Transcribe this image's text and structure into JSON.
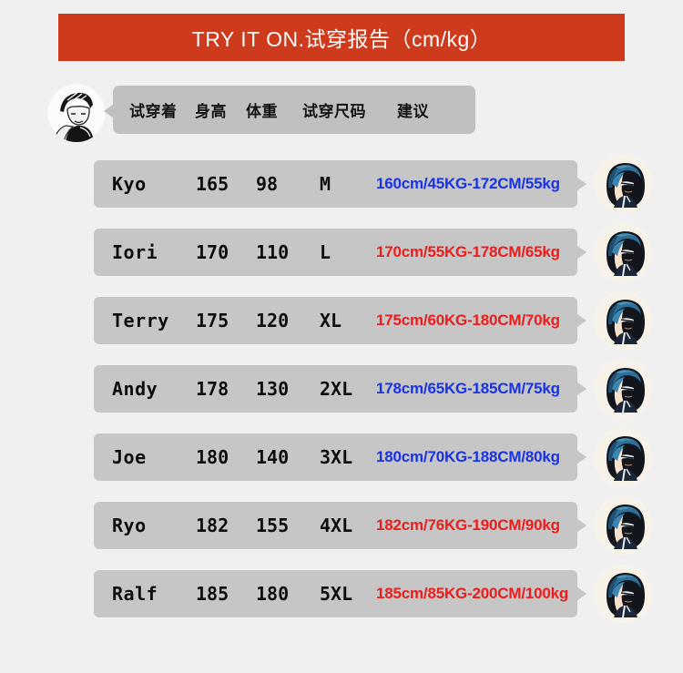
{
  "banner": {
    "title": "TRY IT ON.试穿报告（cm/kg）",
    "bg_color": "#ce3a1c",
    "text_color": "#fdfdfd"
  },
  "header": {
    "avatar_name": "sketch-avatar-icon",
    "columns": [
      "试穿着",
      "身高",
      "体重",
      "试穿尺码",
      "建议"
    ]
  },
  "colors": {
    "page_bg": "#f0f0f0",
    "row_bg": "#c6c6c6",
    "header_bubble_bg": "#c0c0c0",
    "blue": "#1832e6",
    "red": "#ec1c1c",
    "text": "#0d0d0d"
  },
  "rows": [
    {
      "name": "Kyo",
      "height": "165",
      "weight": "98",
      "size": "M",
      "recommendation": "160cm/45KG-172CM/55kg",
      "rec_color": "#1832e6",
      "avatar_name": "anime-boy-avatar-icon"
    },
    {
      "name": "Iori",
      "height": "170",
      "weight": "110",
      "size": "L",
      "recommendation": "170cm/55KG-178CM/65kg",
      "rec_color": "#ec1c1c",
      "avatar_name": "anime-boy-avatar-icon"
    },
    {
      "name": "Terry",
      "height": "175",
      "weight": "120",
      "size": "XL",
      "recommendation": "175cm/60KG-180CM/70kg",
      "rec_color": "#ec1c1c",
      "avatar_name": "anime-boy-avatar-icon"
    },
    {
      "name": "Andy",
      "height": "178",
      "weight": "130",
      "size": "2XL",
      "recommendation": "178cm/65KG-185CM/75kg",
      "rec_color": "#1832e6",
      "avatar_name": "anime-boy-avatar-icon"
    },
    {
      "name": "Joe",
      "height": "180",
      "weight": "140",
      "size": "3XL",
      "recommendation": "180cm/70KG-188CM/80kg",
      "rec_color": "#1832e6",
      "avatar_name": "anime-boy-avatar-icon"
    },
    {
      "name": "Ryo",
      "height": "182",
      "weight": "155",
      "size": "4XL",
      "recommendation": "182cm/76KG-190CM/90kg",
      "rec_color": "#ec1c1c",
      "avatar_name": "anime-boy-avatar-icon"
    },
    {
      "name": "Ralf",
      "height": "185",
      "weight": "180",
      "size": "5XL",
      "recommendation": "185cm/85KG-200CM/100kg",
      "rec_color": "#ec1c1c",
      "avatar_name": "anime-boy-avatar-icon"
    }
  ],
  "layout": {
    "row_top_start": 176,
    "row_spacing": 75
  }
}
